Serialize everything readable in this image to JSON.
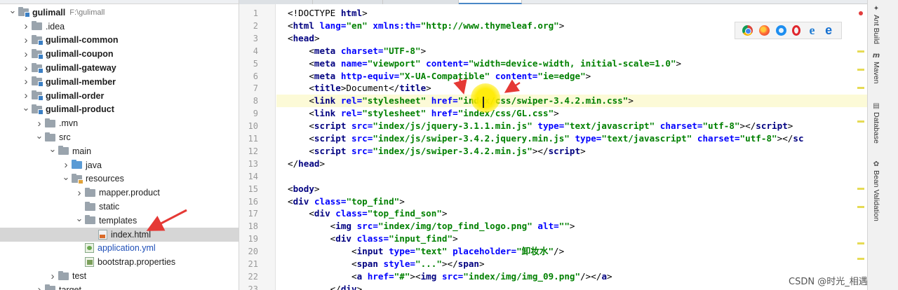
{
  "project_tree": {
    "rows": [
      {
        "label": "gulimall",
        "hint": "F:\\gulimall",
        "level": 0,
        "expanded": true,
        "icon": "module-folder-icon",
        "bold": true
      },
      {
        "label": ".idea",
        "level": 1,
        "expanded": false,
        "icon": "folder-icon",
        "bold": false
      },
      {
        "label": "gulimall-common",
        "level": 1,
        "expanded": false,
        "icon": "module-folder-icon",
        "bold": true
      },
      {
        "label": "gulimall-coupon",
        "level": 1,
        "expanded": false,
        "icon": "module-folder-icon",
        "bold": true
      },
      {
        "label": "gulimall-gateway",
        "level": 1,
        "expanded": false,
        "icon": "module-folder-icon",
        "bold": true
      },
      {
        "label": "gulimall-member",
        "level": 1,
        "expanded": false,
        "icon": "module-folder-icon",
        "bold": true
      },
      {
        "label": "gulimall-order",
        "level": 1,
        "expanded": false,
        "icon": "module-folder-icon",
        "bold": true
      },
      {
        "label": "gulimall-product",
        "level": 1,
        "expanded": true,
        "icon": "module-folder-icon",
        "bold": true
      },
      {
        "label": ".mvn",
        "level": 2,
        "expanded": false,
        "icon": "folder-icon",
        "bold": false
      },
      {
        "label": "src",
        "level": 2,
        "expanded": true,
        "icon": "folder-icon",
        "bold": false
      },
      {
        "label": "main",
        "level": 3,
        "expanded": true,
        "icon": "folder-icon",
        "bold": false
      },
      {
        "label": "java",
        "level": 4,
        "expanded": false,
        "icon": "source-folder-icon",
        "bold": false
      },
      {
        "label": "resources",
        "level": 4,
        "expanded": true,
        "icon": "resources-folder-icon",
        "bold": false
      },
      {
        "label": "mapper.product",
        "level": 5,
        "expanded": false,
        "icon": "folder-icon",
        "bold": false
      },
      {
        "label": "static",
        "level": 5,
        "expanded": null,
        "icon": "folder-icon",
        "bold": false
      },
      {
        "label": "templates",
        "level": 5,
        "expanded": true,
        "icon": "folder-icon",
        "bold": false
      },
      {
        "label": "index.html",
        "level": 6,
        "expanded": null,
        "icon": "html-file-icon",
        "bold": false,
        "selected": true
      },
      {
        "label": "application.yml",
        "level": 5,
        "expanded": null,
        "icon": "yml-file-icon",
        "bold": false,
        "blue": true
      },
      {
        "label": "bootstrap.properties",
        "level": 5,
        "expanded": null,
        "icon": "properties-file-icon",
        "bold": false
      },
      {
        "label": "test",
        "level": 3,
        "expanded": false,
        "icon": "folder-icon",
        "bold": false
      },
      {
        "label": "target",
        "level": 2,
        "expanded": false,
        "icon": "folder-icon",
        "bold": false
      }
    ]
  },
  "editor": {
    "lines": [
      {
        "n": "1",
        "code": [
          [
            "tx",
            "<!DOCTYPE "
          ],
          [
            "tg",
            "html"
          ],
          [
            "tx",
            ">"
          ]
        ]
      },
      {
        "n": "2",
        "code": [
          [
            "tx",
            "<"
          ],
          [
            "tg",
            "html "
          ],
          [
            "at",
            "lang="
          ],
          [
            "st",
            "\"en\" "
          ],
          [
            "at",
            "xmlns:th="
          ],
          [
            "st",
            "\"http://www.thymeleaf.org\""
          ],
          [
            "tx",
            ">"
          ]
        ]
      },
      {
        "n": "3",
        "code": [
          [
            "tx",
            "<"
          ],
          [
            "tg",
            "head"
          ],
          [
            "tx",
            ">"
          ]
        ]
      },
      {
        "n": "4",
        "code": [
          [
            "tx",
            "    <"
          ],
          [
            "tg",
            "meta "
          ],
          [
            "at",
            "charset="
          ],
          [
            "st",
            "\"UTF-8\""
          ],
          [
            "tx",
            ">"
          ]
        ]
      },
      {
        "n": "5",
        "code": [
          [
            "tx",
            "    <"
          ],
          [
            "tg",
            "meta "
          ],
          [
            "at",
            "name="
          ],
          [
            "st",
            "\"viewport\" "
          ],
          [
            "at",
            "content="
          ],
          [
            "st",
            "\"width=device-width, initial-scale=1.0\""
          ],
          [
            "tx",
            ">"
          ]
        ]
      },
      {
        "n": "6",
        "code": [
          [
            "tx",
            "    <"
          ],
          [
            "tg",
            "meta "
          ],
          [
            "at",
            "http-equiv="
          ],
          [
            "st",
            "\"X-UA-Compatible\" "
          ],
          [
            "at",
            "content="
          ],
          [
            "st",
            "\"ie=edge\""
          ],
          [
            "tx",
            ">"
          ]
        ]
      },
      {
        "n": "7",
        "code": [
          [
            "tx",
            "    <"
          ],
          [
            "tg",
            "title"
          ],
          [
            "tx",
            ">Document</"
          ],
          [
            "tg",
            "title"
          ],
          [
            "tx",
            ">"
          ]
        ]
      },
      {
        "n": "8",
        "code": [
          [
            "tx",
            "    <"
          ],
          [
            "tg",
            "link "
          ],
          [
            "at",
            "rel="
          ],
          [
            "st",
            "\"stylesheet\" "
          ],
          [
            "at",
            "href="
          ],
          [
            "st",
            "\"index/css/swiper-3.4.2.min.css\""
          ],
          [
            "tx",
            ">"
          ]
        ],
        "highlight": true
      },
      {
        "n": "9",
        "code": [
          [
            "tx",
            "    <"
          ],
          [
            "tg",
            "link "
          ],
          [
            "at",
            "rel="
          ],
          [
            "st",
            "\"stylesheet\" "
          ],
          [
            "at",
            "href="
          ],
          [
            "st",
            "\"index/css/GL.css\""
          ],
          [
            "tx",
            ">"
          ]
        ]
      },
      {
        "n": "10",
        "code": [
          [
            "tx",
            "    <"
          ],
          [
            "tg",
            "script "
          ],
          [
            "at",
            "src="
          ],
          [
            "st",
            "\"index/js/jquery-3.1.1.min.js\" "
          ],
          [
            "at",
            "type="
          ],
          [
            "st",
            "\"text/javascript\" "
          ],
          [
            "at",
            "charset="
          ],
          [
            "st",
            "\"utf-8\""
          ],
          [
            "tx",
            "></"
          ],
          [
            "tg",
            "script"
          ],
          [
            "tx",
            ">"
          ]
        ]
      },
      {
        "n": "11",
        "code": [
          [
            "tx",
            "    <"
          ],
          [
            "tg",
            "script "
          ],
          [
            "at",
            "src="
          ],
          [
            "st",
            "\"index/js/swiper-3.4.2.jquery.min.js\" "
          ],
          [
            "at",
            "type="
          ],
          [
            "st",
            "\"text/javascript\" "
          ],
          [
            "at",
            "charset="
          ],
          [
            "st",
            "\"utf-8\""
          ],
          [
            "tx",
            "></"
          ],
          [
            "tg",
            "sc"
          ]
        ]
      },
      {
        "n": "12",
        "code": [
          [
            "tx",
            "    <"
          ],
          [
            "tg",
            "script "
          ],
          [
            "at",
            "src="
          ],
          [
            "st",
            "\"index/js/swiper-3.4.2.min.js\""
          ],
          [
            "tx",
            "></"
          ],
          [
            "tg",
            "script"
          ],
          [
            "tx",
            ">"
          ]
        ]
      },
      {
        "n": "13",
        "code": [
          [
            "tx",
            "</"
          ],
          [
            "tg",
            "head"
          ],
          [
            "tx",
            ">"
          ]
        ]
      },
      {
        "n": "14",
        "code": []
      },
      {
        "n": "15",
        "code": [
          [
            "tx",
            "<"
          ],
          [
            "tg",
            "body"
          ],
          [
            "tx",
            ">"
          ]
        ]
      },
      {
        "n": "16",
        "code": [
          [
            "tx",
            "<"
          ],
          [
            "tg",
            "div "
          ],
          [
            "at",
            "class="
          ],
          [
            "st",
            "\"top_find\""
          ],
          [
            "tx",
            ">"
          ]
        ]
      },
      {
        "n": "17",
        "code": [
          [
            "tx",
            "    <"
          ],
          [
            "tg",
            "div "
          ],
          [
            "at",
            "class="
          ],
          [
            "st",
            "\"top_find_son\""
          ],
          [
            "tx",
            ">"
          ]
        ]
      },
      {
        "n": "18",
        "code": [
          [
            "tx",
            "        <"
          ],
          [
            "tg",
            "img "
          ],
          [
            "at",
            "src="
          ],
          [
            "st",
            "\"index/img/top_find_logo.png\" "
          ],
          [
            "at",
            "alt="
          ],
          [
            "st",
            "\"\""
          ],
          [
            "tx",
            ">"
          ]
        ]
      },
      {
        "n": "19",
        "code": [
          [
            "tx",
            "        <"
          ],
          [
            "tg",
            "div "
          ],
          [
            "at",
            "class="
          ],
          [
            "st",
            "\"input_find\""
          ],
          [
            "tx",
            ">"
          ]
        ]
      },
      {
        "n": "20",
        "code": [
          [
            "tx",
            "            <"
          ],
          [
            "tg",
            "input "
          ],
          [
            "at",
            "type="
          ],
          [
            "st",
            "\"text\" "
          ],
          [
            "at",
            "placeholder="
          ],
          [
            "st",
            "\"卸妆水\""
          ],
          [
            "tx",
            "/>"
          ]
        ]
      },
      {
        "n": "21",
        "code": [
          [
            "tx",
            "            <"
          ],
          [
            "tg",
            "span "
          ],
          [
            "at",
            "style="
          ],
          [
            "st",
            "\"...\""
          ],
          [
            "tx",
            "></"
          ],
          [
            "tg",
            "span"
          ],
          [
            "tx",
            ">"
          ]
        ]
      },
      {
        "n": "22",
        "code": [
          [
            "tx",
            "            <"
          ],
          [
            "tg",
            "a "
          ],
          [
            "at",
            "href="
          ],
          [
            "st",
            "\"#\""
          ],
          [
            "tx",
            "><"
          ],
          [
            "tg",
            "img "
          ],
          [
            "at",
            "src="
          ],
          [
            "st",
            "\"index/img/img_09.png\""
          ],
          [
            "tx",
            "/></"
          ],
          [
            "tg",
            "a"
          ],
          [
            "tx",
            ">"
          ]
        ]
      },
      {
        "n": "23",
        "code": [
          [
            "tx",
            "        </"
          ],
          [
            "tg",
            "div"
          ],
          [
            "tx",
            ">"
          ]
        ]
      }
    ]
  },
  "browsers": [
    "chrome-icon",
    "firefox-icon",
    "safari-icon",
    "opera-icon",
    "ie-icon",
    "edge-icon"
  ],
  "tool_windows": [
    {
      "label": "Ant Build",
      "icon": "ant-icon"
    },
    {
      "label": "Maven",
      "icon": "maven-icon"
    },
    {
      "label": "Database",
      "icon": "database-icon"
    },
    {
      "label": "Bean Validation",
      "icon": "bean-validation-icon"
    }
  ],
  "watermark": "CSDN @时光_相遇",
  "colors": {
    "tag": "#000080",
    "attribute": "#0000ff",
    "string": "#008000",
    "annotation": "#e53935",
    "cursor_highlight": "#ffeb00"
  }
}
